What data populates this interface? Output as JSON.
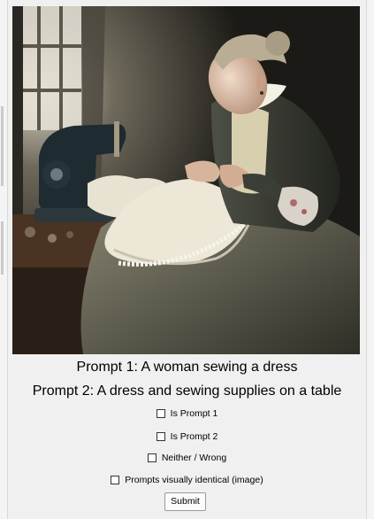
{
  "image": {
    "alt_icon": "painting-woman-sewing-icon"
  },
  "prompts": {
    "prompt1": "Prompt 1: A woman sewing a dress",
    "prompt2": "Prompt 2: A dress and sewing supplies on a table"
  },
  "options": [
    {
      "label": "Is Prompt 1",
      "checked": false
    },
    {
      "label": "Is Prompt 2",
      "checked": false
    },
    {
      "label": "Neither / Wrong",
      "checked": false
    },
    {
      "label": "Prompts visually identical (image)",
      "checked": false
    }
  ],
  "submit_label": "Submit"
}
